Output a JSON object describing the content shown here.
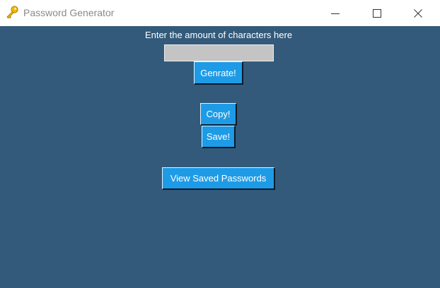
{
  "window": {
    "title": "Password Generator",
    "icon": "key-icon",
    "controls": [
      "minimize-icon",
      "maximize-icon",
      "close-icon"
    ],
    "background_color": "#335a7a"
  },
  "form": {
    "prompt": "Enter the amount of characters here",
    "input_value": ""
  },
  "buttons": {
    "generate": "Genrate!",
    "copy": "Copy!",
    "save": "Save!",
    "view_saved": "View Saved Passwords",
    "accent_color": "#1e9be6"
  }
}
